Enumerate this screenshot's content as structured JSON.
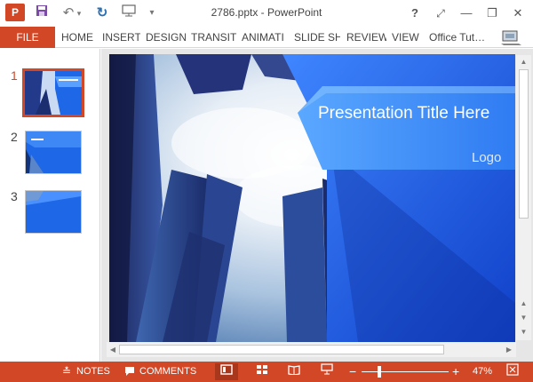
{
  "app": {
    "icon_text": "P",
    "window_title": "2786.pptx - PowerPoint"
  },
  "quick_access": {
    "icons": [
      "save-icon",
      "undo-icon",
      "undo-dropdown-icon",
      "redo-icon",
      "slideshow-from-start-icon",
      "customize-toolbar-icon"
    ]
  },
  "window_controls": {
    "help": "?",
    "ribbon_options": "⤢",
    "minimize": "—",
    "restore": "❐",
    "close": "✕"
  },
  "ribbon": {
    "file_tab": "FILE",
    "tabs": [
      "HOME",
      "INSERT",
      "DESIGN",
      "TRANSITI",
      "ANIMATI",
      "SLIDE SH",
      "REVIEW",
      "VIEW"
    ],
    "account": "Office Tut…"
  },
  "thumbnails": [
    {
      "number": "1",
      "active": true
    },
    {
      "number": "2",
      "active": false
    },
    {
      "number": "3",
      "active": false
    }
  ],
  "slide": {
    "title": "Presentation Title Here",
    "logo": "Logo"
  },
  "status_bar": {
    "notes_label": "NOTES",
    "comments_label": "COMMENTS",
    "zoom_minus": "−",
    "zoom_plus": "+",
    "zoom_percent": "47%",
    "zoom_level": 0.47
  },
  "colors": {
    "accent": "#d24726",
    "slide_blue": "#1e67e6",
    "slide_blue_light": "#56a2ff"
  }
}
